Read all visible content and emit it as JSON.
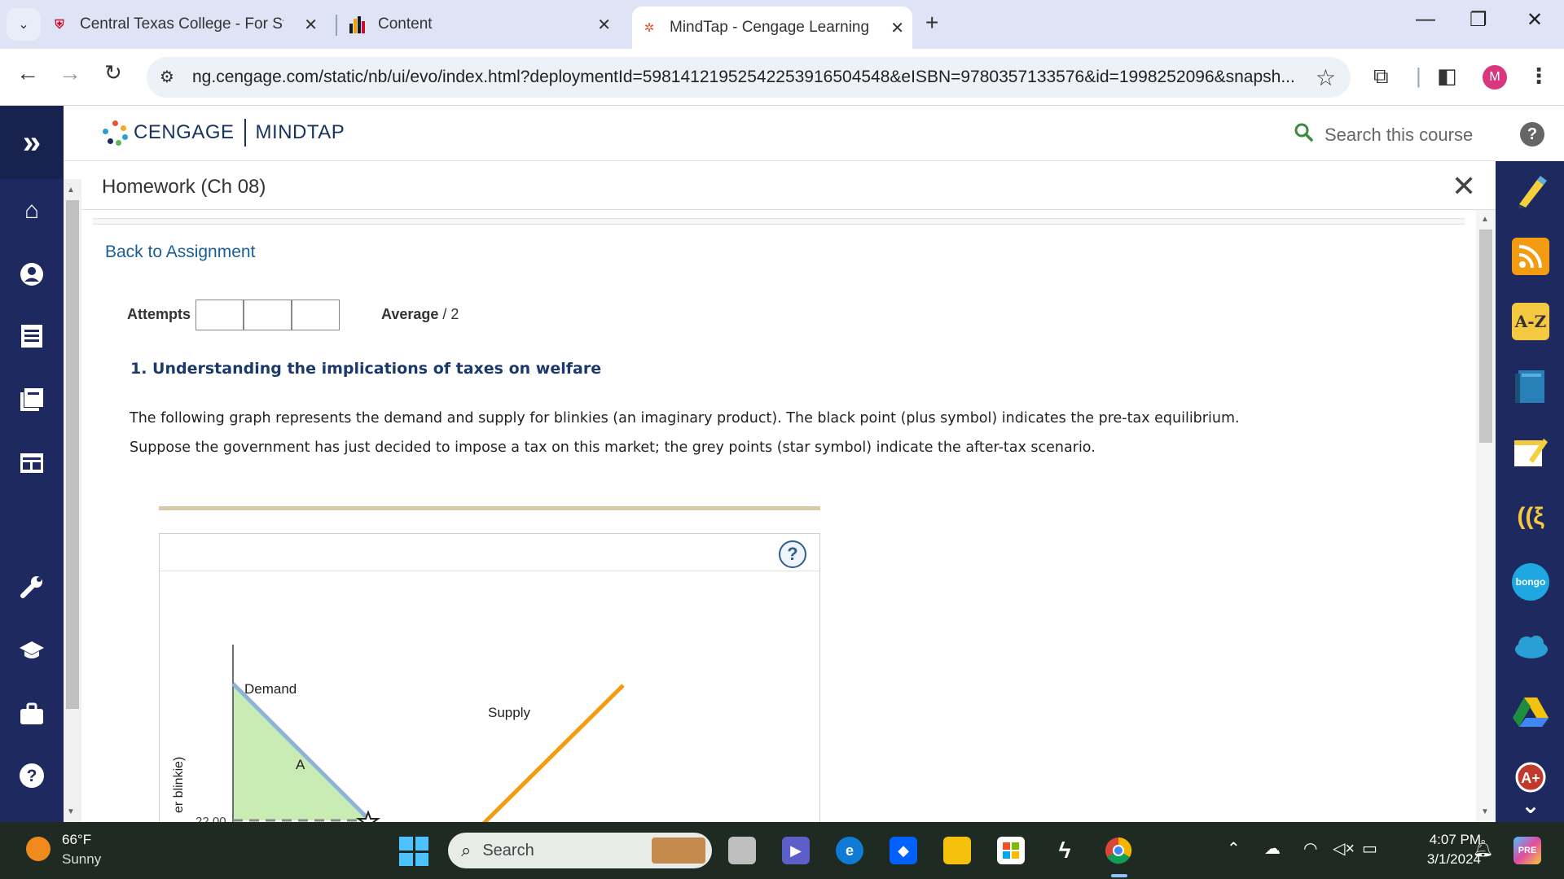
{
  "browser": {
    "tabs": [
      {
        "title": "Central Texas College - For Stud",
        "active": false
      },
      {
        "title": "Content",
        "active": false
      },
      {
        "title": "MindTap - Cengage Learning",
        "active": true
      }
    ],
    "url": "ng.cengage.com/static/nb/ui/evo/index.html?deploymentId=59814121952542253916504548&eISBN=9780357133576&id=1998252096&snapsh...",
    "profile_initial": "M"
  },
  "app": {
    "brand_left": "CENGAGE",
    "brand_right": "MINDTAP",
    "search_placeholder": "Search this course"
  },
  "homework": {
    "title": "Homework (Ch 08)",
    "back_link": "Back to Assignment",
    "attempts_label": "Attempts",
    "average_label": "Average",
    "average_value": "/ 2",
    "question_title": "1. Understanding the implications of taxes on welfare",
    "question_text": "The following graph represents the demand and supply for blinkies (an imaginary product). The black point (plus symbol) indicates the pre-tax equilibrium. Suppose the government has just decided to impose a tax on this market; the grey points (star symbol) indicate the after-tax scenario."
  },
  "graph": {
    "demand_label": "Demand",
    "supply_label": "Supply",
    "area_label": "A",
    "y_axis_label": "er blinkie)",
    "tick_label": "22.00",
    "colors": {
      "demand": "#8fb2d9",
      "supply": "#f39c12",
      "area": "#c9ecb5"
    }
  },
  "taskbar": {
    "temp": "66°F",
    "weather": "Sunny",
    "search": "Search",
    "time": "4:07 PM",
    "date": "3/1/2024"
  }
}
